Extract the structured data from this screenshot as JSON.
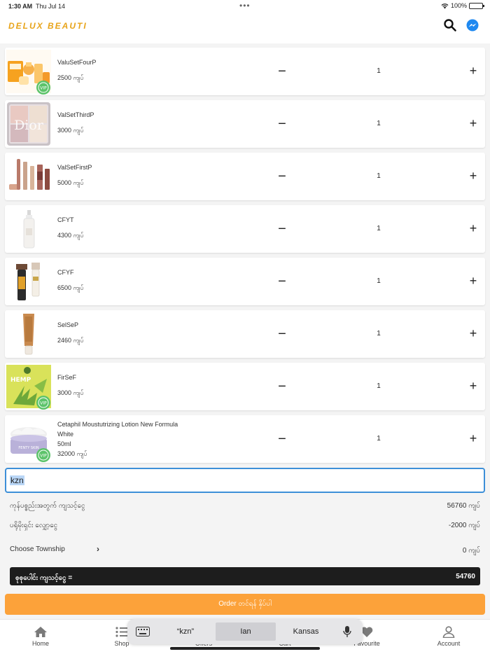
{
  "status": {
    "time": "1:30 AM",
    "date": "Thu Jul 14",
    "battery": "100%"
  },
  "app": {
    "brand": "DELUX BEAUTI"
  },
  "cart": {
    "items": [
      {
        "name": "ValuSetFourP",
        "name2": "",
        "size": "",
        "price": "2500 ကျပ်",
        "qty": "1",
        "image": "orange-skincare-set",
        "vip": true
      },
      {
        "name": "ValSetThirdP",
        "name2": "",
        "size": "",
        "price": "3000 ကျပ်",
        "qty": "1",
        "image": "dior-highlighter-palette",
        "vip": false
      },
      {
        "name": "ValSetFirstP",
        "name2": "",
        "size": "",
        "price": "5000 ကျပ်",
        "qty": "1",
        "image": "lipstick-set",
        "vip": false
      },
      {
        "name": "CFYT",
        "name2": "",
        "size": "",
        "price": "4300 ကျပ်",
        "qty": "1",
        "image": "white-spray-bottle",
        "vip": false
      },
      {
        "name": "CFYF",
        "name2": "",
        "size": "",
        "price": "6500 ကျပ်",
        "qty": "1",
        "image": "serum-tubes",
        "vip": false
      },
      {
        "name": "SelSeP",
        "name2": "",
        "size": "",
        "price": "2460 ကျပ်",
        "qty": "1",
        "image": "foundation-tube",
        "vip": false
      },
      {
        "name": "FirSeF",
        "name2": "",
        "size": "",
        "price": "3000 ကျပ်",
        "qty": "1",
        "image": "hemp-sheet-mask",
        "vip": true
      },
      {
        "name": "Cetaphil Moustutrizing Lotion New Formula",
        "name2": "White",
        "size": "50ml",
        "price": "32000 ကျပ်",
        "qty": "1",
        "image": "cream-jar",
        "vip": true
      }
    ]
  },
  "address": {
    "value": "kzn"
  },
  "summary": {
    "subtotal_label": "ကုန်ပစ္စည်းအတွက် ကျသင့်ငွေ",
    "subtotal_value": "56760 ကျပ်",
    "discount_label": "ပရိုမိုးရှင်း လျှော့ငွေ",
    "discount_value": "-2000 ကျပ်",
    "township_label": "Choose Township",
    "township_value": "0 ကျပ်",
    "total_label": "စုစုပေါင်း ကျသင့်ငွေ   =",
    "total_value": "54760"
  },
  "order_button": "Order တင်ရန် နှိပ်ပါ",
  "tabs": [
    {
      "label": "Home",
      "icon": "home-icon"
    },
    {
      "label": "Shop",
      "icon": "list-icon"
    },
    {
      "label": "Offers",
      "icon": "offers-icon"
    },
    {
      "label": "Cart",
      "icon": "cart-icon"
    },
    {
      "label": "Favourite",
      "icon": "heart-icon"
    },
    {
      "label": "Account",
      "icon": "person-icon"
    }
  ],
  "keyboard": {
    "suggestions": [
      "“kzn”",
      "Ian",
      "Kansas"
    ]
  },
  "colors": {
    "brand": "#e8a41a",
    "order_button": "#fca23a",
    "total_bar": "#1d1d1d",
    "focus": "#3d8fd8",
    "vip_badge": "#5cc36a"
  }
}
